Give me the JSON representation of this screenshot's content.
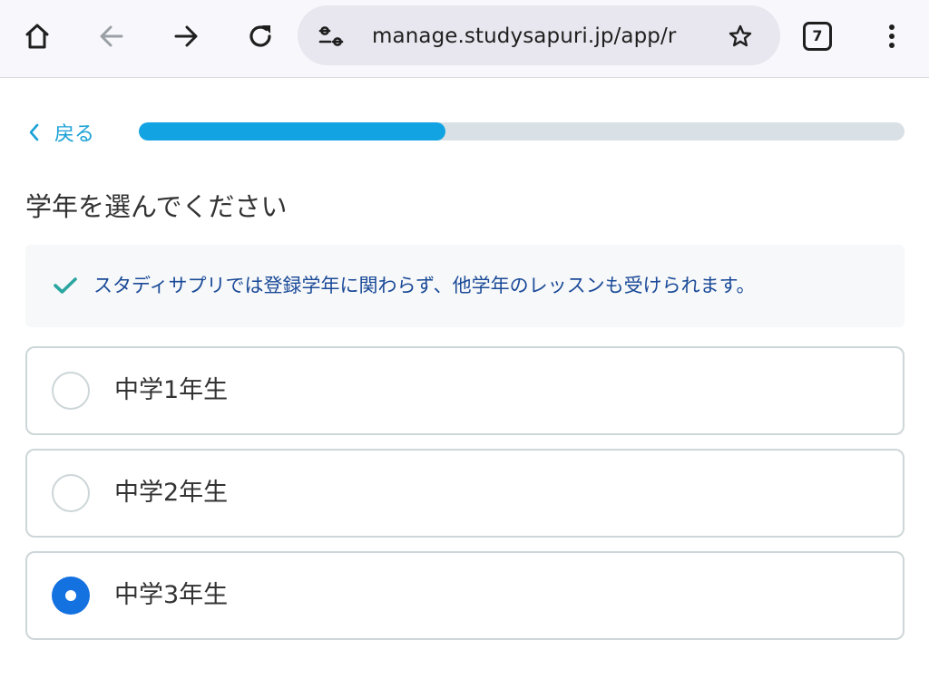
{
  "browser": {
    "url": "manage.studysapuri.jp/app/r",
    "tab_count": "7"
  },
  "nav": {
    "back_label": "戻る"
  },
  "progress": {
    "fraction": 0.4
  },
  "page": {
    "heading": "学年を選んでください",
    "notice": "スタディサプリでは登録学年に関わらず、他学年のレッスンも受けられます。"
  },
  "grade_options": [
    {
      "label": "中学1年生",
      "selected": false
    },
    {
      "label": "中学2年生",
      "selected": false
    },
    {
      "label": "中学3年生",
      "selected": true
    }
  ],
  "colors": {
    "accent": "#12a3e3",
    "radio_selected": "#1371e0",
    "notice_text": "#1a4a98",
    "check_icon": "#2aa5a0"
  }
}
